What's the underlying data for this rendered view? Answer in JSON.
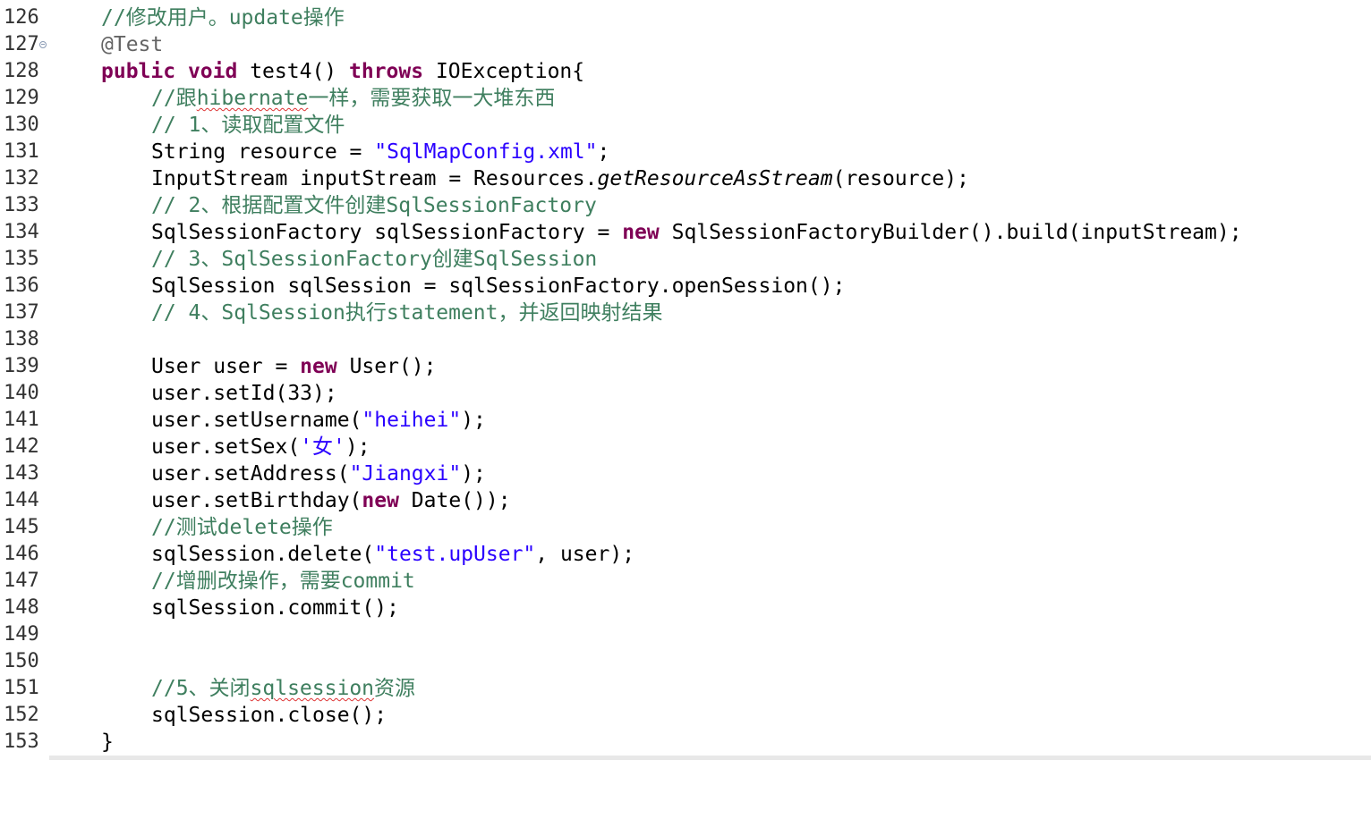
{
  "editor": {
    "lines": [
      {
        "num": "126",
        "comment": "//修改用户。update操作"
      },
      {
        "num": "127",
        "annotation": "@Test"
      },
      {
        "num": "128",
        "kw1": "public",
        "kw2": "void",
        "name": "test4()",
        "kw3": "throws",
        "rest": "IOException{"
      },
      {
        "num": "129",
        "c1": "//跟",
        "c2": "hibernate",
        "c3": "一样，需要获取一大堆东西"
      },
      {
        "num": "130",
        "comment": "// 1、读取配置文件"
      },
      {
        "num": "131",
        "pre": "String resource = ",
        "str": "\"SqlMapConfig.xml\"",
        "post": ";"
      },
      {
        "num": "132",
        "pre": "InputStream inputStream = Resources.",
        "italic": "getResourceAsStream",
        "post": "(resource);"
      },
      {
        "num": "133",
        "comment": "// 2、根据配置文件创建SqlSessionFactory"
      },
      {
        "num": "134",
        "pre": "SqlSessionFactory sqlSessionFactory = ",
        "kw": "new",
        "post": " SqlSessionFactoryBuilder().build(inputStream);"
      },
      {
        "num": "135",
        "comment": "// 3、SqlSessionFactory创建SqlSession"
      },
      {
        "num": "136",
        "text": "SqlSession sqlSession = sqlSessionFactory.openSession();"
      },
      {
        "num": "137",
        "comment": "// 4、SqlSession执行statement，并返回映射结果"
      },
      {
        "num": "138"
      },
      {
        "num": "139",
        "pre": "User user = ",
        "kw": "new",
        "post": " User();"
      },
      {
        "num": "140",
        "text": "user.setId(33);"
      },
      {
        "num": "141",
        "pre": "user.setUsername(",
        "str": "\"heihei\"",
        "post": ");"
      },
      {
        "num": "142",
        "pre": "user.setSex(",
        "str": "'女'",
        "post": ");"
      },
      {
        "num": "143",
        "pre": "user.setAddress(",
        "str": "\"Jiangxi\"",
        "post": ");"
      },
      {
        "num": "144",
        "pre": "user.setBirthday(",
        "kw": "new",
        "post": " Date());"
      },
      {
        "num": "145",
        "comment": "//测试delete操作"
      },
      {
        "num": "146",
        "pre": "sqlSession.delete(",
        "str": "\"test.upUser\"",
        "post": ", user);"
      },
      {
        "num": "147",
        "comment": "//增删改操作，需要commit"
      },
      {
        "num": "148",
        "text": "sqlSession.commit();"
      },
      {
        "num": "149"
      },
      {
        "num": "150"
      },
      {
        "num": "151",
        "c1": "//5、关闭",
        "c2": "sqlsession",
        "c3": "资源"
      },
      {
        "num": "152",
        "text": "sqlSession.close();"
      },
      {
        "num": "153",
        "text": "}"
      }
    ]
  },
  "colors": {
    "keyword": "#7f0055",
    "comment": "#3f7f5f",
    "string": "#2a00ff",
    "annotation": "#646464",
    "line_number": "#333333"
  },
  "icons": {
    "fold_marker": "collapse-fold-icon"
  }
}
